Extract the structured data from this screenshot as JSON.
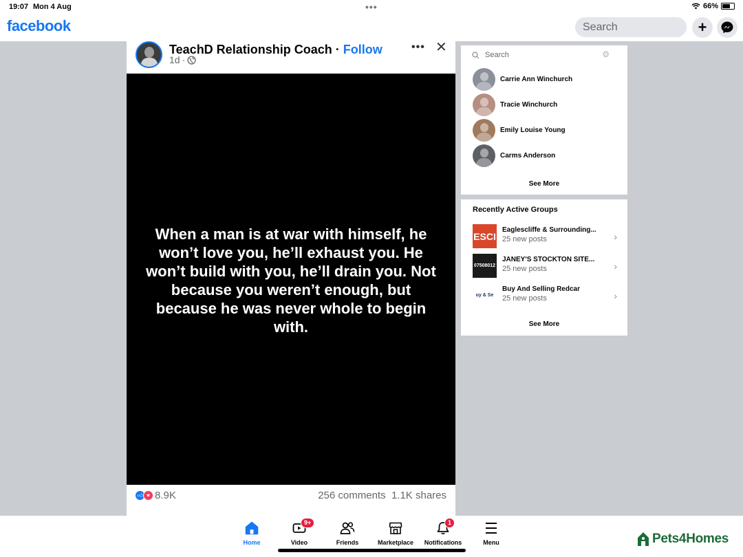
{
  "status_bar": {
    "time": "19:07",
    "date": "Mon 4 Aug",
    "battery": "66%",
    "battery_level": 0.66
  },
  "header": {
    "logo": "facebook",
    "search_placeholder": "Search",
    "plus_icon": "plus-icon",
    "messenger_icon": "messenger-icon"
  },
  "post": {
    "page_name": "TeachD Relationship Coach",
    "separator": " · ",
    "follow_label": "Follow",
    "time": "1d",
    "meta_separator": "·",
    "privacy_icon": "globe-icon",
    "quote": "When a man is at war with himself, he won’t love you, he’ll exhaust you. He won’t build with you, he’ll drain you. Not because you weren’t enough, but because he was never whole to begin with.",
    "reactions_count": "8.9K",
    "comments": "256 comments",
    "shares": "1.1K shares"
  },
  "contacts": {
    "search_placeholder": "Search",
    "items": [
      {
        "name": "Carrie Ann Winchurch",
        "color": "#8a8f99"
      },
      {
        "name": "Tracie Winchurch",
        "color": "#b58f82"
      },
      {
        "name": "Emily Louise Young",
        "color": "#a07a5e"
      },
      {
        "name": "Carms Anderson",
        "color": "#5c6066"
      }
    ],
    "see_more": "See More"
  },
  "groups": {
    "title": "Recently Active Groups",
    "items": [
      {
        "name": "Eaglescliffe & Surrounding...",
        "posts": "25 new posts",
        "thumb_text": "ESCI",
        "thumb_bg": "#d9472b",
        "thumb_fg": "#ffffff"
      },
      {
        "name": "JANEY'S STOCKTON SITE...",
        "posts": "25 new posts",
        "thumb_text": "07508012",
        "thumb_bg": "#1b1b1b",
        "thumb_fg": "#ffffff"
      },
      {
        "name": "Buy And Selling Redcar",
        "posts": "25 new posts",
        "thumb_text": "uy & Se",
        "thumb_bg": "#ffffff",
        "thumb_fg": "#14325e"
      }
    ],
    "see_more": "See More"
  },
  "tabbar": {
    "home": "Home",
    "video": "Video",
    "video_badge": "9+",
    "friends": "Friends",
    "marketplace": "Marketplace",
    "notifications": "Notifications",
    "notifications_badge": "1",
    "menu": "Menu"
  },
  "watermark": "Pets4Homes",
  "colors": {
    "brand": "#1877f2",
    "badge": "#e41e3f",
    "backdrop": "#c9ccd1"
  }
}
